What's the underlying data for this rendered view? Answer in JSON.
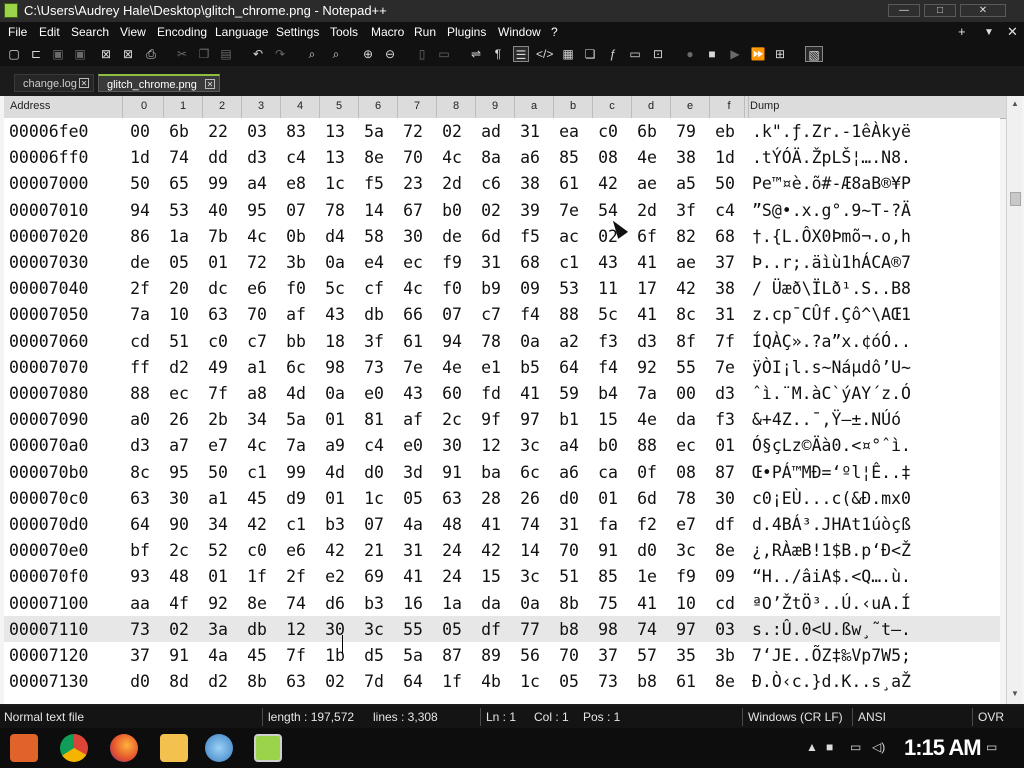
{
  "window": {
    "title": "C:\\Users\\Audrey Hale\\Desktop\\glitch_chrome.png - Notepad++",
    "controls": {
      "minimize": "—",
      "maximize": "□",
      "close": "✕"
    }
  },
  "menu": {
    "items": [
      "File",
      "Edit",
      "Search",
      "View",
      "Encoding",
      "Language",
      "Settings",
      "Tools",
      "Macro",
      "Run",
      "Plugins",
      "Window",
      "?"
    ],
    "right": [
      "+",
      "▼",
      "✕"
    ]
  },
  "tabs": [
    {
      "label": "change.log"
    },
    {
      "label": "glitch_chrome.png"
    }
  ],
  "tab_close_glyph": "✕",
  "hex_header": {
    "address": "Address",
    "columns": [
      "0",
      "1",
      "2",
      "3",
      "4",
      "5",
      "6",
      "7",
      "8",
      "9",
      "a",
      "b",
      "c",
      "d",
      "e",
      "f"
    ],
    "dump": "Dump"
  },
  "rows": [
    {
      "addr": "00006fe0",
      "bytes": [
        "00",
        "6b",
        "22",
        "03",
        "83",
        "13",
        "5a",
        "72",
        "02",
        "ad",
        "31",
        "ea",
        "c0",
        "6b",
        "79",
        "eb"
      ],
      "dump": ".k\".ƒ.Zr.-1êÀkyë"
    },
    {
      "addr": "00006ff0",
      "bytes": [
        "1d",
        "74",
        "dd",
        "d3",
        "c4",
        "13",
        "8e",
        "70",
        "4c",
        "8a",
        "a6",
        "85",
        "08",
        "4e",
        "38",
        "1d"
      ],
      "dump": ".tÝÓÄ.ŽpLŠ¦….N8."
    },
    {
      "addr": "00007000",
      "bytes": [
        "50",
        "65",
        "99",
        "a4",
        "e8",
        "1c",
        "f5",
        "23",
        "2d",
        "c6",
        "38",
        "61",
        "42",
        "ae",
        "a5",
        "50"
      ],
      "dump": "Pe™¤è.õ#-Æ8aB®¥P"
    },
    {
      "addr": "00007010",
      "bytes": [
        "94",
        "53",
        "40",
        "95",
        "07",
        "78",
        "14",
        "67",
        "b0",
        "02",
        "39",
        "7e",
        "54",
        "2d",
        "3f",
        "c4"
      ],
      "dump": "”S@•.x.g°.9~T-?Ä"
    },
    {
      "addr": "00007020",
      "bytes": [
        "86",
        "1a",
        "7b",
        "4c",
        "0b",
        "d4",
        "58",
        "30",
        "de",
        "6d",
        "f5",
        "ac",
        "02",
        "6f",
        "82",
        "68"
      ],
      "dump": "†.{L.ÔX0Þmõ¬.o‚h"
    },
    {
      "addr": "00007030",
      "bytes": [
        "de",
        "05",
        "01",
        "72",
        "3b",
        "0a",
        "e4",
        "ec",
        "f9",
        "31",
        "68",
        "c1",
        "43",
        "41",
        "ae",
        "37"
      ],
      "dump": "Þ..r;.äìù1hÁCA®7"
    },
    {
      "addr": "00007040",
      "bytes": [
        "2f",
        "20",
        "dc",
        "e6",
        "f0",
        "5c",
        "cf",
        "4c",
        "f0",
        "b9",
        "09",
        "53",
        "11",
        "17",
        "42",
        "38"
      ],
      "dump": "/ Üæð\\ÏLð¹.S..B8"
    },
    {
      "addr": "00007050",
      "bytes": [
        "7a",
        "10",
        "63",
        "70",
        "af",
        "43",
        "db",
        "66",
        "07",
        "c7",
        "f4",
        "88",
        "5c",
        "41",
        "8c",
        "31"
      ],
      "dump": "z.cp¯CÛf.Çô^\\AŒ1"
    },
    {
      "addr": "00007060",
      "bytes": [
        "cd",
        "51",
        "c0",
        "c7",
        "bb",
        "18",
        "3f",
        "61",
        "94",
        "78",
        "0a",
        "a2",
        "f3",
        "d3",
        "8f",
        "7f"
      ],
      "dump": "ÍQÀÇ».?a”x.¢óÓ.."
    },
    {
      "addr": "00007070",
      "bytes": [
        "ff",
        "d2",
        "49",
        "a1",
        "6c",
        "98",
        "73",
        "7e",
        "4e",
        "e1",
        "b5",
        "64",
        "f4",
        "92",
        "55",
        "7e"
      ],
      "dump": "ÿÒI¡l.s~Náµdô’U~"
    },
    {
      "addr": "00007080",
      "bytes": [
        "88",
        "ec",
        "7f",
        "a8",
        "4d",
        "0a",
        "e0",
        "43",
        "60",
        "fd",
        "41",
        "59",
        "b4",
        "7a",
        "00",
        "d3"
      ],
      "dump": "ˆì.¨M.àC`ýAY´z.Ó"
    },
    {
      "addr": "00007090",
      "bytes": [
        "a0",
        "26",
        "2b",
        "34",
        "5a",
        "01",
        "81",
        "af",
        "2c",
        "9f",
        "97",
        "b1",
        "15",
        "4e",
        "da",
        "f3"
      ],
      "dump": " &+4Z..¯,Ÿ—±.NÚó"
    },
    {
      "addr": "000070a0",
      "bytes": [
        "d3",
        "a7",
        "e7",
        "4c",
        "7a",
        "a9",
        "c4",
        "e0",
        "30",
        "12",
        "3c",
        "a4",
        "b0",
        "88",
        "ec",
        "01"
      ],
      "dump": "Ó§çLz©Äà0.<¤°ˆì."
    },
    {
      "addr": "000070b0",
      "bytes": [
        "8c",
        "95",
        "50",
        "c1",
        "99",
        "4d",
        "d0",
        "3d",
        "91",
        "ba",
        "6c",
        "a6",
        "ca",
        "0f",
        "08",
        "87"
      ],
      "dump": "Œ•PÁ™MÐ=‘ºl¦Ê..‡"
    },
    {
      "addr": "000070c0",
      "bytes": [
        "63",
        "30",
        "a1",
        "45",
        "d9",
        "01",
        "1c",
        "05",
        "63",
        "28",
        "26",
        "d0",
        "01",
        "6d",
        "78",
        "30"
      ],
      "dump": "c0¡EÙ...c(&Ð.mx0"
    },
    {
      "addr": "000070d0",
      "bytes": [
        "64",
        "90",
        "34",
        "42",
        "c1",
        "b3",
        "07",
        "4a",
        "48",
        "41",
        "74",
        "31",
        "fa",
        "f2",
        "e7",
        "df"
      ],
      "dump": "d.4BÁ³.JHAt1úòçß"
    },
    {
      "addr": "000070e0",
      "bytes": [
        "bf",
        "2c",
        "52",
        "c0",
        "e6",
        "42",
        "21",
        "31",
        "24",
        "42",
        "14",
        "70",
        "91",
        "d0",
        "3c",
        "8e"
      ],
      "dump": "¿,RÀæB!1$B.p‘Ð<Ž"
    },
    {
      "addr": "000070f0",
      "bytes": [
        "93",
        "48",
        "01",
        "1f",
        "2f",
        "e2",
        "69",
        "41",
        "24",
        "15",
        "3c",
        "51",
        "85",
        "1e",
        "f9",
        "09"
      ],
      "dump": "“H../âiA$.<Q….ù."
    },
    {
      "addr": "00007100",
      "bytes": [
        "aa",
        "4f",
        "92",
        "8e",
        "74",
        "d6",
        "b3",
        "16",
        "1a",
        "da",
        "0a",
        "8b",
        "75",
        "41",
        "10",
        "cd"
      ],
      "dump": "ªO’ŽtÖ³..Ú.‹uA.Í"
    },
    {
      "addr": "00007110",
      "bytes": [
        "73",
        "02",
        "3a",
        "db",
        "12",
        "30",
        "3c",
        "55",
        "05",
        "df",
        "77",
        "b8",
        "98",
        "74",
        "97",
        "03"
      ],
      "dump": "s.:Û.0<U.ßw¸˜t—."
    },
    {
      "addr": "00007120",
      "bytes": [
        "37",
        "91",
        "4a",
        "45",
        "7f",
        "1b",
        "d5",
        "5a",
        "87",
        "89",
        "56",
        "70",
        "37",
        "57",
        "35",
        "3b"
      ],
      "dump": "7‘JE..ÕZ‡‰Vp7W5;"
    },
    {
      "addr": "00007130",
      "bytes": [
        "d0",
        "8d",
        "d2",
        "8b",
        "63",
        "02",
        "7d",
        "64",
        "1f",
        "4b",
        "1c",
        "05",
        "73",
        "b8",
        "61",
        "8e"
      ],
      "dump": "Ð.Ò‹c.}d.K..s¸aŽ"
    }
  ],
  "status": {
    "type": "Normal text file",
    "length": "length : 197,572",
    "lines": "lines : 3,308",
    "ln": "Ln : 1",
    "col": "Col : 1",
    "pos": "Pos : 1",
    "eol": "Windows (CR LF)",
    "encoding": "ANSI",
    "mode": "OVR"
  },
  "taskbar": {
    "time": "1:15 AM"
  },
  "colors": {
    "accent": "#8fbf3f",
    "titlebar": "#2b2b2b",
    "menubar": "#111111",
    "editor_bg": "#ffffff",
    "highlight_row": "#e7e7e7"
  }
}
